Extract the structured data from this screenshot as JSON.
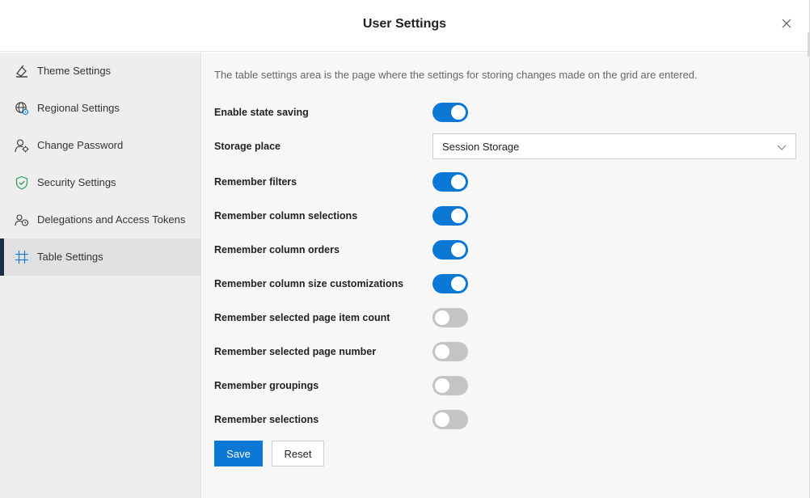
{
  "dialog": {
    "title": "User Settings"
  },
  "sidebar": {
    "items": [
      {
        "label": "Theme Settings",
        "icon": "theme-icon",
        "active": false
      },
      {
        "label": "Regional Settings",
        "icon": "globe-icon",
        "active": false
      },
      {
        "label": "Change Password",
        "icon": "user-key-icon",
        "active": false
      },
      {
        "label": "Security Settings",
        "icon": "shield-icon",
        "active": false
      },
      {
        "label": "Delegations and Access Tokens",
        "icon": "people-icon",
        "active": false
      },
      {
        "label": "Table Settings",
        "icon": "grid-icon",
        "active": true
      }
    ]
  },
  "content": {
    "description": "The table settings area is the page where the settings for storing changes made on the grid are entered.",
    "enable_state_saving": {
      "label": "Enable state saving",
      "on": true
    },
    "storage_place": {
      "label": "Storage place",
      "value": "Session Storage"
    },
    "options": [
      {
        "label": "Remember filters",
        "on": true
      },
      {
        "label": "Remember column selections",
        "on": true
      },
      {
        "label": "Remember column orders",
        "on": true
      },
      {
        "label": "Remember column size customizations",
        "on": true
      },
      {
        "label": "Remember selected page item count",
        "on": false
      },
      {
        "label": "Remember selected page number",
        "on": false
      },
      {
        "label": "Remember groupings",
        "on": false
      },
      {
        "label": "Remember selections",
        "on": false
      }
    ],
    "save_label": "Save",
    "reset_label": "Reset"
  },
  "colors": {
    "accent": "#0a78d4",
    "toggle_off": "#c4c4c4",
    "active_indicator": "#1c2e4a"
  }
}
